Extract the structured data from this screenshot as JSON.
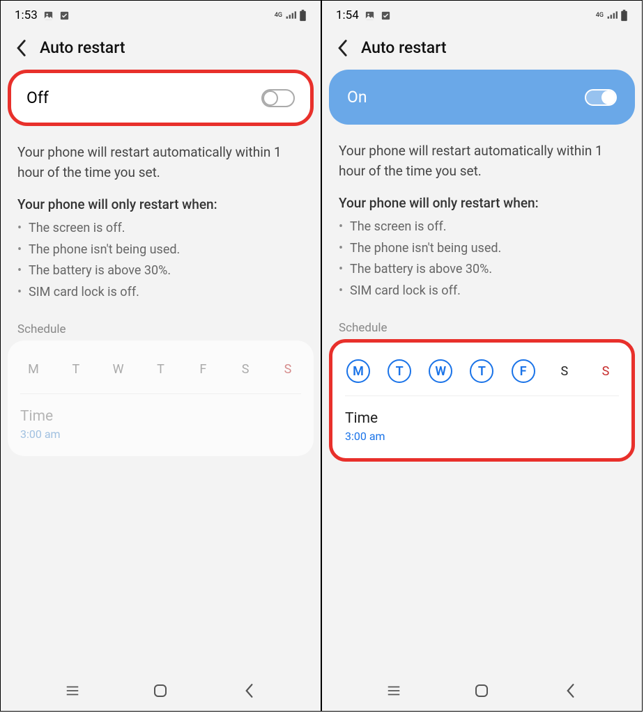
{
  "left": {
    "status": {
      "time": "1:53",
      "network": "4G"
    },
    "title": "Auto restart",
    "toggle_label": "Off",
    "description": "Your phone will restart automatically within 1 hour of the time you set.",
    "conditions_title": "Your phone will only restart when:",
    "conditions": [
      "The screen is off.",
      "The phone isn't being used.",
      "The battery is above 30%.",
      "SIM card lock is off."
    ],
    "schedule_label": "Schedule",
    "days": [
      "M",
      "T",
      "W",
      "T",
      "F",
      "S",
      "S"
    ],
    "time_label": "Time",
    "time_value": "3:00 am"
  },
  "right": {
    "status": {
      "time": "1:54",
      "network": "4G"
    },
    "title": "Auto restart",
    "toggle_label": "On",
    "description": "Your phone will restart automatically within 1 hour of the time you set.",
    "conditions_title": "Your phone will only restart when:",
    "conditions": [
      "The screen is off.",
      "The phone isn't being used.",
      "The battery is above 30%.",
      "SIM card lock is off."
    ],
    "schedule_label": "Schedule",
    "days": [
      "M",
      "T",
      "W",
      "T",
      "F",
      "S",
      "S"
    ],
    "time_label": "Time",
    "time_value": "3:00 am"
  }
}
